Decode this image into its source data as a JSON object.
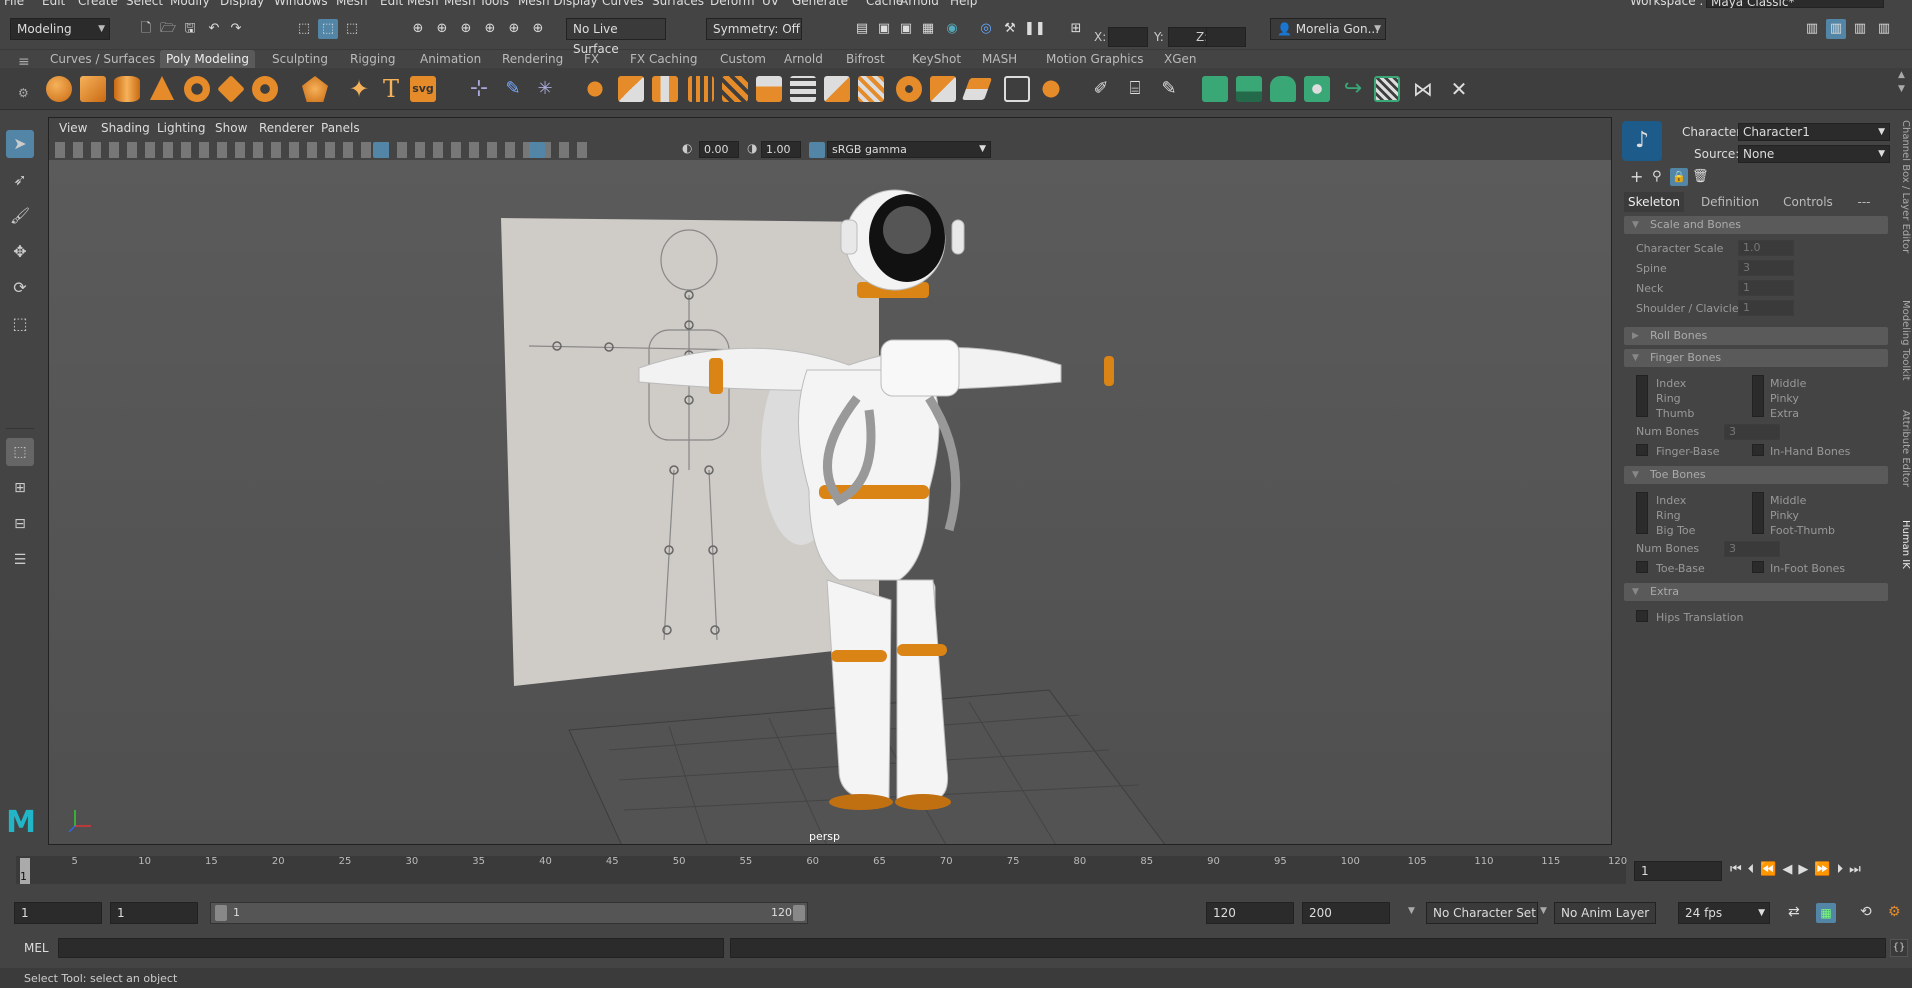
{
  "menubar": {
    "items": [
      "File",
      "Edit",
      "Create",
      "Select",
      "Modify",
      "Display",
      "Windows",
      "Mesh",
      "Edit Mesh",
      "Mesh Tools",
      "Mesh Display",
      "Curves",
      "Surfaces",
      "Deform",
      "UV",
      "Generate",
      "Cache",
      "Arnold",
      "Help"
    ],
    "workspace_label": "Workspace :",
    "workspace_value": "Maya Classic*"
  },
  "statusline": {
    "mode": "Modeling",
    "live_surface": "No Live Surface",
    "symmetry": "Symmetry: Off",
    "x_label": "X:",
    "y_label": "Y:",
    "z_label": "Z:",
    "user": "Morelia Gon..."
  },
  "shelf_tabs": [
    "Curves / Surfaces",
    "Poly Modeling",
    "Sculpting",
    "Rigging",
    "Animation",
    "Rendering",
    "FX",
    "FX Caching",
    "Custom",
    "Arnold",
    "Bifrost",
    "KeyShot",
    "MASH",
    "Motion Graphics",
    "XGen"
  ],
  "shelf_active": "Poly Modeling",
  "shelf_icon_svg": "svg",
  "viewport": {
    "menus": [
      "View",
      "Shading",
      "Lighting",
      "Show",
      "Renderer",
      "Panels"
    ],
    "exposure": "0.00",
    "gamma": "1.00",
    "colorspace": "sRGB gamma",
    "camera": "persp"
  },
  "hik": {
    "character_label": "Character:",
    "character_value": "Character1",
    "source_label": "Source:",
    "source_value": "None",
    "tabs": [
      "Skeleton",
      "Definition",
      "Controls",
      "---"
    ],
    "sections": {
      "scale_bones": "Scale and Bones",
      "roll_bones": "Roll Bones",
      "finger_bones": "Finger Bones",
      "toe_bones": "Toe Bones",
      "extra": "Extra"
    },
    "scale": [
      {
        "label": "Character Scale",
        "value": "1.0"
      },
      {
        "label": "Spine",
        "value": "3"
      },
      {
        "label": "Neck",
        "value": "1"
      },
      {
        "label": "Shoulder / Clavicle",
        "value": "1"
      }
    ],
    "finger_left": [
      "Index",
      "Ring",
      "Thumb"
    ],
    "finger_right": [
      "Middle",
      "Pinky",
      "Extra"
    ],
    "num_bones_label": "Num Bones",
    "finger_num": "3",
    "finger_base": "Finger-Base",
    "in_hand": "In-Hand Bones",
    "toe_left": [
      "Index",
      "Ring",
      "Big Toe"
    ],
    "toe_right": [
      "Middle",
      "Pinky",
      "Foot-Thumb"
    ],
    "toe_num": "3",
    "toe_base": "Toe-Base",
    "in_foot": "In-Foot Bones",
    "hips": "Hips Translation"
  },
  "side_tabs": [
    "Channel Box / Layer Editor",
    "Modeling Toolkit",
    "Attribute Editor",
    "Human IK"
  ],
  "timeline": {
    "ticks": [
      5,
      10,
      15,
      20,
      25,
      30,
      35,
      40,
      45,
      50,
      55,
      60,
      65,
      70,
      75,
      80,
      85,
      90,
      95,
      100,
      105,
      110,
      115,
      120
    ],
    "current": "1",
    "current_field": "1"
  },
  "range": {
    "start": "1",
    "start2": "1",
    "slider_start": "1",
    "slider_end": "120",
    "end": "120",
    "end2": "200",
    "char_set": "No Character Set",
    "anim_layer": "No Anim Layer",
    "fps": "24 fps"
  },
  "cmd": {
    "lang": "MEL"
  },
  "help": {
    "text": "Select Tool: select an object"
  }
}
